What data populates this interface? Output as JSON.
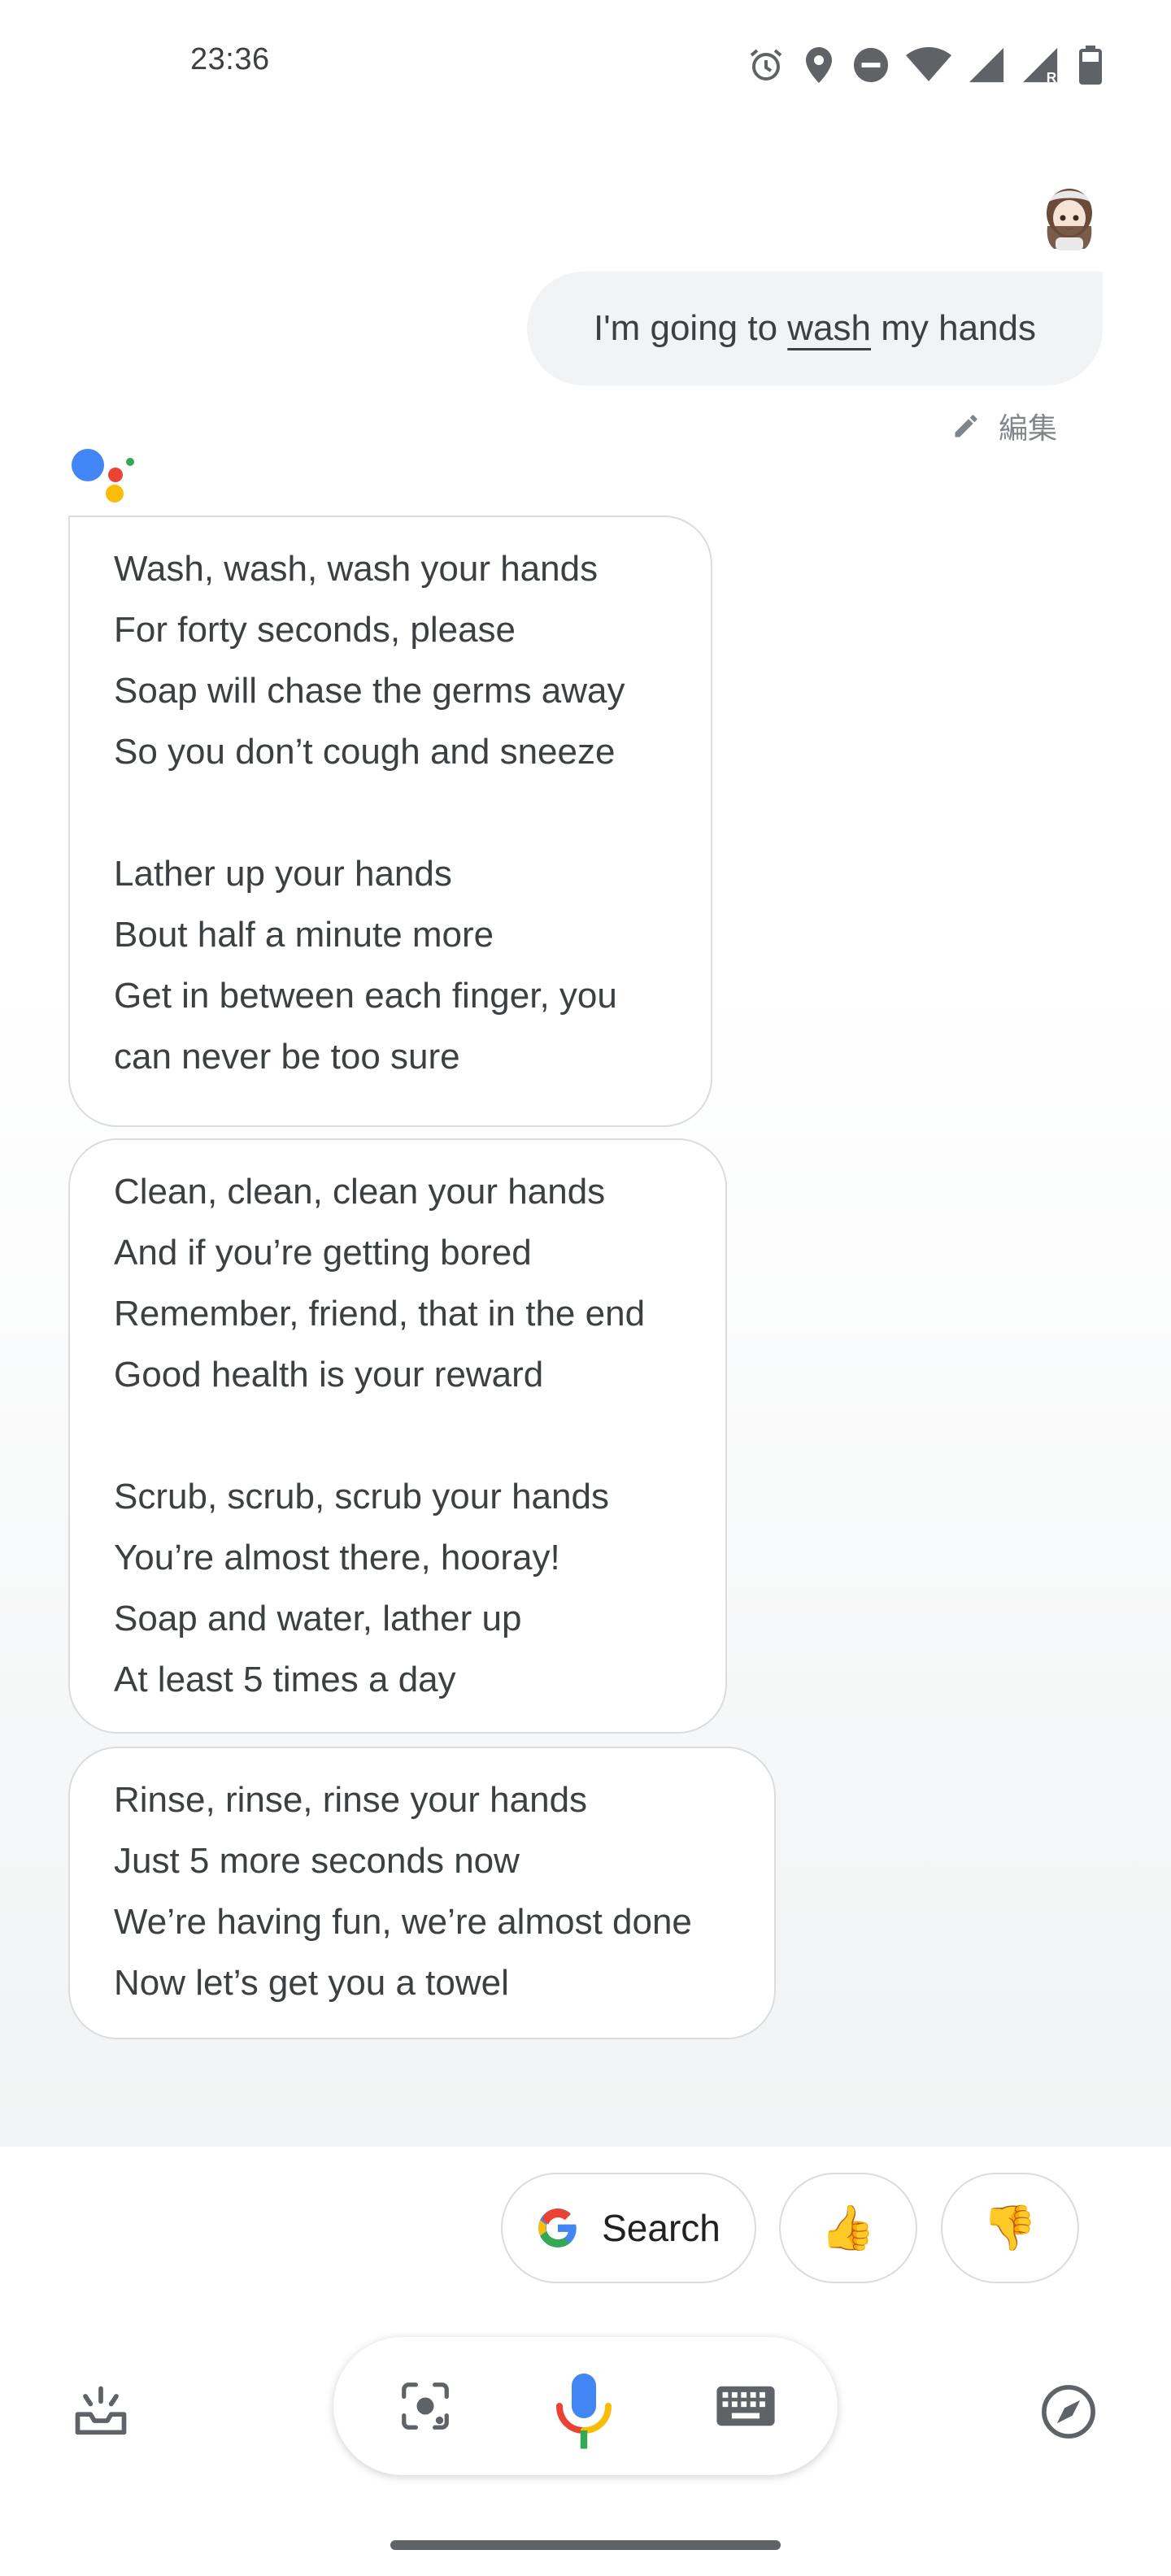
{
  "status_bar": {
    "time": "23:36",
    "icons": [
      "alarm-icon",
      "location-icon",
      "do-not-disturb-icon",
      "wifi-icon",
      "signal-icon",
      "signal-roaming-icon",
      "battery-icon"
    ]
  },
  "user_message": {
    "before": "I'm going to ",
    "underlined": "wash",
    "after": " my hands"
  },
  "edit_label": "編集",
  "assistant_bubbles": [
    {
      "lines": [
        "Wash, wash, wash your hands",
        "For forty seconds, please",
        "Soap will chase the germs away",
        "So you don’t cough and sneeze",
        "",
        "Lather up your hands",
        "Bout half a minute more",
        "Get in between each finger, you",
        "can never be too sure"
      ]
    },
    {
      "lines": [
        "Clean, clean, clean your hands",
        "And if you’re getting bored",
        "Remember, friend, that in the end",
        "Good health is your reward",
        "",
        "Scrub, scrub, scrub your hands",
        "You’re almost there, hooray!",
        "Soap and water, lather up",
        "At least 5 times a day"
      ]
    },
    {
      "lines": [
        "Rinse, rinse, rinse your hands",
        "Just 5 more seconds now",
        "We’re having fun, we’re almost done",
        "Now let’s get you a towel"
      ]
    }
  ],
  "chips": {
    "search_label": "Search",
    "thumbs_up": "👍",
    "thumbs_down": "👎"
  },
  "bottom_bar": {
    "left_icon": "updates-inbox-icon",
    "right_icon": "explore-compass-icon",
    "pill_icons": [
      "lens-icon",
      "mic-icon",
      "keyboard-icon"
    ]
  },
  "colors": {
    "google_blue": "#4285F4",
    "google_red": "#EA4335",
    "google_yellow": "#FBBC05",
    "google_green": "#34A853",
    "bubble_bg_user": "#f1f3f4",
    "text": "#3c4043"
  }
}
